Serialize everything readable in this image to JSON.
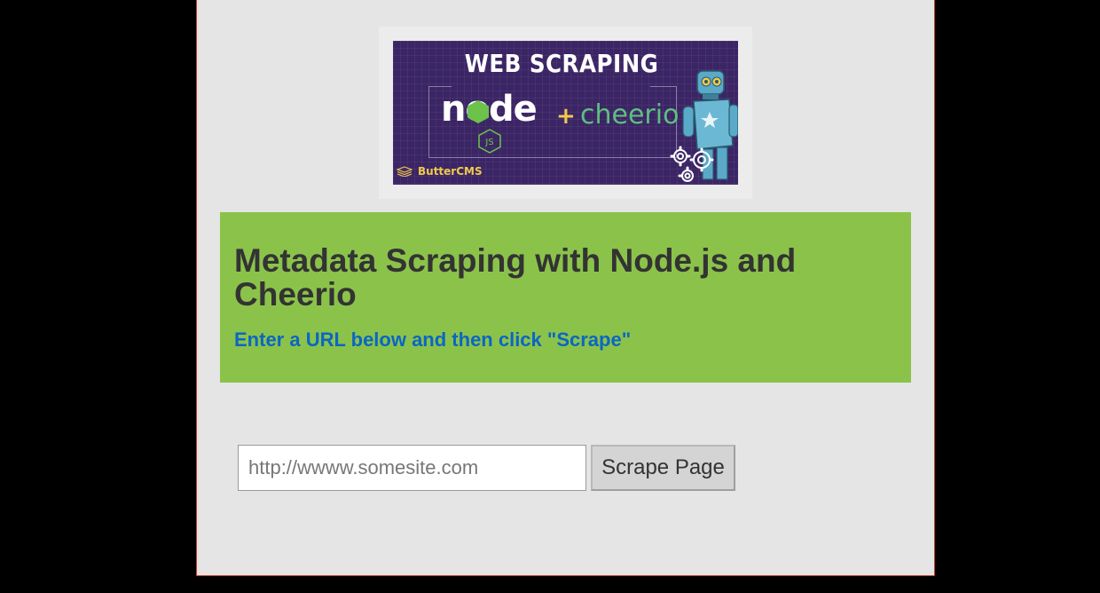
{
  "banner": {
    "title": "WEB SCRAPING",
    "node_word": "node",
    "js_badge": "JS",
    "plus": "+",
    "cheerio_word": "cheerio",
    "brand": "ButterCMS"
  },
  "hero": {
    "title": "Metadata Scraping with Node.js and Cheerio",
    "subtitle": "Enter a URL below and then click \"Scrape\""
  },
  "form": {
    "url_placeholder": "http://wwww.somesite.com",
    "url_value": "",
    "submit_label": "Scrape Page"
  },
  "colors": {
    "page_background": "#e5e5e5",
    "hero_background": "#8bc34a",
    "subtitle_blue": "#0b66c3",
    "banner_purple": "#3b2565",
    "outer_background": "#000000"
  },
  "icons": {
    "node_hexagon": "node-hexagon-icon",
    "js_hexagon": "js-hexagon-icon",
    "buttercms": "buttercms-logo-icon",
    "robot": "robot-icon",
    "gears": "gears-icon"
  }
}
